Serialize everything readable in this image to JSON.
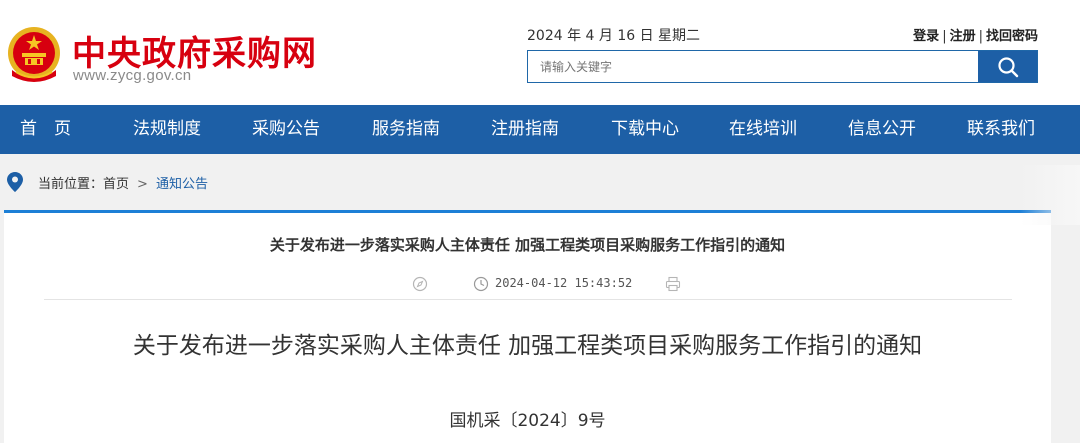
{
  "header": {
    "site_title": "中央政府采购网",
    "site_url": "www.zycg.gov.cn",
    "date": "2024 年 4 月 16 日    星期二",
    "auth": {
      "login": "登录",
      "register": "注册",
      "recover": "找回密码"
    },
    "search": {
      "placeholder": "请输入关键字"
    }
  },
  "nav": {
    "items": [
      "首　页",
      "法规制度",
      "采购公告",
      "服务指南",
      "注册指南",
      "下载中心",
      "在线培训",
      "信息公开",
      "联系我们"
    ]
  },
  "breadcrumb": {
    "label": "当前位置：",
    "home": "首页",
    "separator": ">",
    "current": "通知公告"
  },
  "article": {
    "head_title": "关于发布进一步落实采购人主体责任 加强工程类项目采购服务工作指引的通知",
    "published": "2024-04-12 15:43:52",
    "title": "关于发布进一步落实采购人主体责任 加强工程类项目采购服务工作指引的通知",
    "doc_number": "国机采〔2024〕9号"
  },
  "colors": {
    "brand_red": "#d7000f",
    "nav_blue": "#1d5fa6",
    "accent_blue": "#1d7fd6"
  }
}
